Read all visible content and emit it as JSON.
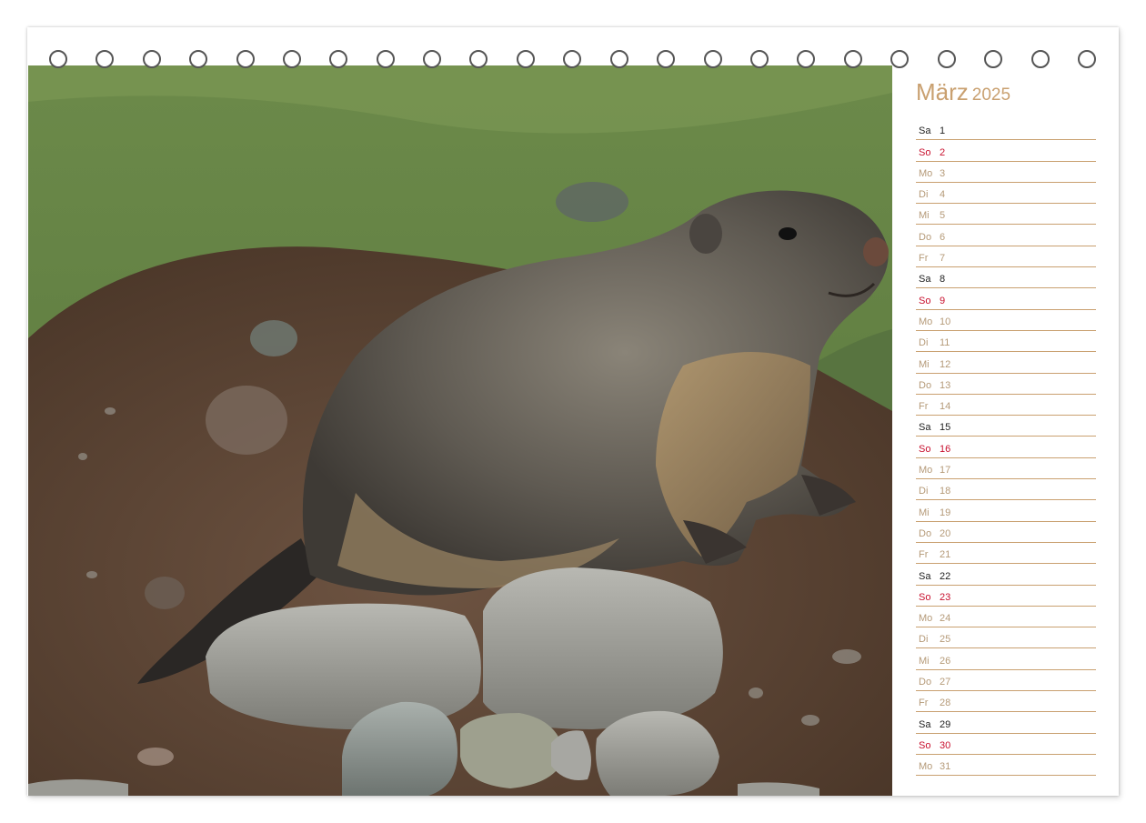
{
  "calendar": {
    "month": "März",
    "year": "2025",
    "days": [
      {
        "wd": "Sa",
        "d": "1"
      },
      {
        "wd": "So",
        "d": "2"
      },
      {
        "wd": "Mo",
        "d": "3"
      },
      {
        "wd": "Di",
        "d": "4"
      },
      {
        "wd": "Mi",
        "d": "5"
      },
      {
        "wd": "Do",
        "d": "6"
      },
      {
        "wd": "Fr",
        "d": "7"
      },
      {
        "wd": "Sa",
        "d": "8"
      },
      {
        "wd": "So",
        "d": "9"
      },
      {
        "wd": "Mo",
        "d": "10"
      },
      {
        "wd": "Di",
        "d": "11"
      },
      {
        "wd": "Mi",
        "d": "12"
      },
      {
        "wd": "Do",
        "d": "13"
      },
      {
        "wd": "Fr",
        "d": "14"
      },
      {
        "wd": "Sa",
        "d": "15"
      },
      {
        "wd": "So",
        "d": "16"
      },
      {
        "wd": "Mo",
        "d": "17"
      },
      {
        "wd": "Di",
        "d": "18"
      },
      {
        "wd": "Mi",
        "d": "19"
      },
      {
        "wd": "Do",
        "d": "20"
      },
      {
        "wd": "Fr",
        "d": "21"
      },
      {
        "wd": "Sa",
        "d": "22"
      },
      {
        "wd": "So",
        "d": "23"
      },
      {
        "wd": "Mo",
        "d": "24"
      },
      {
        "wd": "Di",
        "d": "25"
      },
      {
        "wd": "Mi",
        "d": "26"
      },
      {
        "wd": "Do",
        "d": "27"
      },
      {
        "wd": "Fr",
        "d": "28"
      },
      {
        "wd": "Sa",
        "d": "29"
      },
      {
        "wd": "So",
        "d": "30"
      },
      {
        "wd": "Mo",
        "d": "31"
      }
    ]
  },
  "colors": {
    "accent": "#c9a070",
    "sunday": "#c8102e",
    "saturday": "#222222",
    "weekday": "#b59a78"
  },
  "photo": {
    "subject": "marmot-photo"
  }
}
